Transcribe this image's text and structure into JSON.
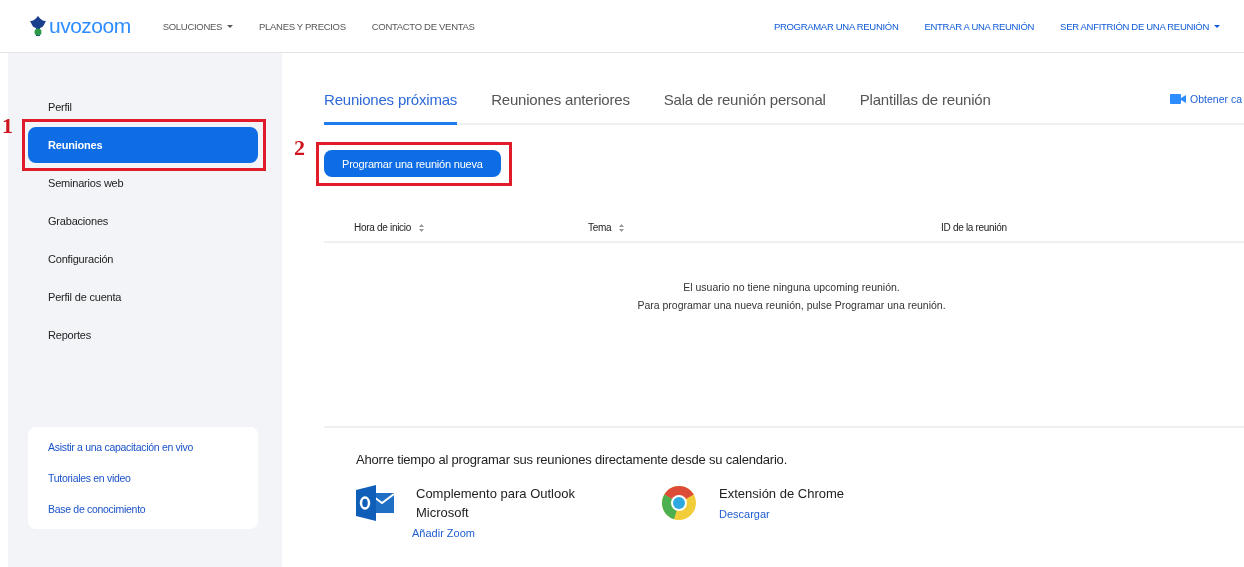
{
  "header": {
    "logo": "uvozoom",
    "nav_left": [
      {
        "label": "SOLUCIONES",
        "dropdown": true
      },
      {
        "label": "PLANES Y PRECIOS",
        "dropdown": false
      },
      {
        "label": "CONTACTO DE VENTAS",
        "dropdown": false
      }
    ],
    "nav_right": [
      {
        "label": "PROGRAMAR UNA REUNIÓN",
        "dropdown": false
      },
      {
        "label": "ENTRAR A UNA REUNIÓN",
        "dropdown": false
      },
      {
        "label": "SER ANFITRIÓN DE UNA REUNIÓN",
        "dropdown": true
      }
    ]
  },
  "sidebar": {
    "items": [
      {
        "label": "Perfil",
        "selected": false
      },
      {
        "label": "Reuniones",
        "selected": true,
        "annotation": "1"
      },
      {
        "label": "Seminarios web",
        "selected": false
      },
      {
        "label": "Grabaciones",
        "selected": false
      },
      {
        "label": "Configuración",
        "selected": false
      },
      {
        "label": "Perfil de cuenta",
        "selected": false
      },
      {
        "label": "Reportes",
        "selected": false
      }
    ],
    "help_links": [
      "Asistir a una capacitación en vivo",
      "Tutoriales en video",
      "Base de conocimiento"
    ]
  },
  "tabs": [
    {
      "label": "Reuniones próximas",
      "selected": true
    },
    {
      "label": "Reuniones anteriores",
      "selected": false
    },
    {
      "label": "Sala de reunión personal",
      "selected": false
    },
    {
      "label": "Plantillas de reunión",
      "selected": false
    }
  ],
  "tab_link": "Obtener ca",
  "schedule_button": {
    "label": "Programar una reunión nueva",
    "annotation": "2"
  },
  "table": {
    "columns": [
      {
        "label": "Hora de inicio",
        "sortable": true
      },
      {
        "label": "Tema",
        "sortable": true
      },
      {
        "label": "ID de la reunión",
        "sortable": false
      }
    ],
    "empty_message": [
      "El usuario no tiene ninguna upcoming reunión.",
      "Para programar una nueva reunión, pulse Programar una reunión."
    ]
  },
  "calendar": {
    "heading": "Ahorre tiempo al programar sus reuniones directamente desde su calendario.",
    "items": [
      {
        "kind": "outlook",
        "title": "Complemento para Outlook Microsoft",
        "link": "Añadir Zoom"
      },
      {
        "kind": "chrome",
        "title": "Extensión de Chrome",
        "link": "Descargar"
      }
    ]
  }
}
